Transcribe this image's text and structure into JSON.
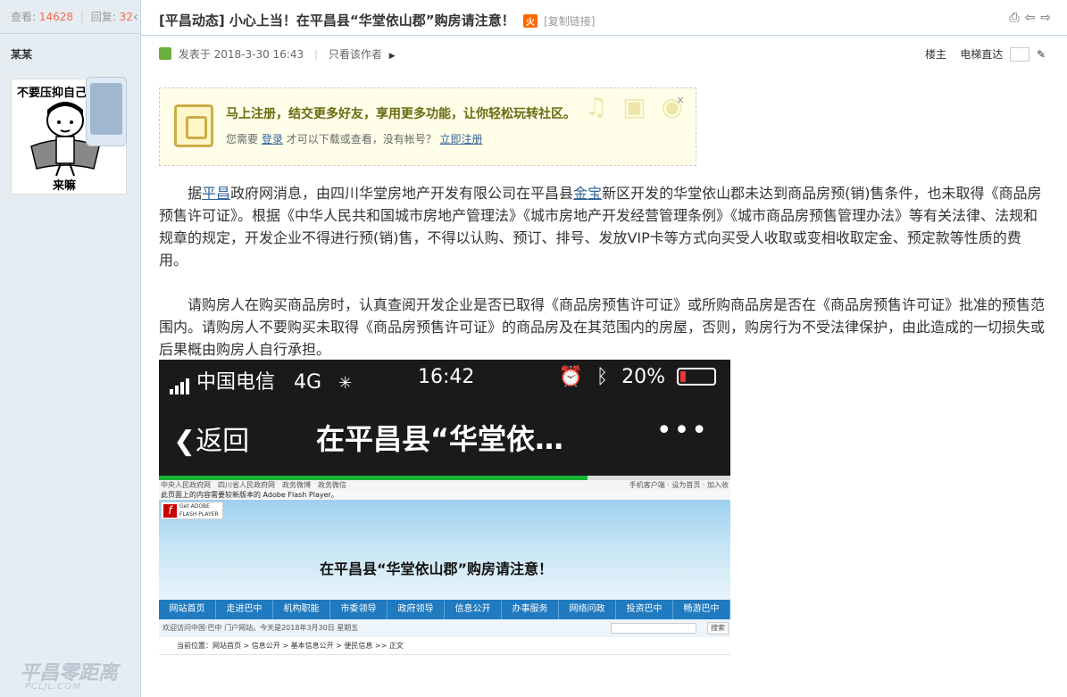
{
  "left": {
    "views_label": "查看:",
    "views": "14628",
    "sep": "|",
    "replies_label": "回复:",
    "replies": "32",
    "author": "某某",
    "avatar_caption_top": "不要压抑自己",
    "avatar_caption_bottom": "来嘛",
    "watermark": "平昌零距离",
    "watermark_sub": "PCLJL.COM"
  },
  "thread": {
    "title": "[平昌动态] 小心上当！在平昌县“华堂依山郡”购房请注意！",
    "hot_badge": "火",
    "copy_link": "[复制链接]",
    "posted_label": "发表于 2018-3-30 16:43",
    "only_author": "只看该作者",
    "floor": "楼主",
    "jump_label": "电梯直达"
  },
  "register_prompt": {
    "headline": "马上注册，结交更多好友，享用更多功能，让你轻松玩转社区。",
    "sub_prefix": "您需要",
    "login": "登录",
    "sub_mid": "才可以下载或查看，没有帐号？",
    "register": "立即注册"
  },
  "post": {
    "p1_start": "据",
    "p1_link1": "平昌",
    "p1_mid": "政府网消息，由四川华堂房地产开发有限公司在平昌县",
    "p1_link2": "金宝",
    "p1_rest": "新区开发的华堂依山郡未达到商品房预(销)售条件，也未取得《商品房预售许可证》。根据《中华人民共和国城市房地产管理法》《城市房地产开发经营管理条例》《城市商品房预售管理办法》等有关法律、法规和规章的规定，开发企业不得进行预(销)售，不得以认购、预订、排号、发放VIP卡等方式向买受人收取或变相收取定金、预定款等性质的费用。",
    "p2": "请购房人在购买商品房时，认真查阅开发企业是否已取得《商品房预售许可证》或所购商品房是否在《商品房预售许可证》批准的预售范围内。请购房人不要购买未取得《商品房预售许可证》的商品房及在其范围内的房屋，否则，购房行为不受法律保护，由此造成的一切损失或后果概由购房人自行承担。"
  },
  "screenshot": {
    "carrier": "中国电信",
    "network": "4G",
    "time": "16:42",
    "battery": "20%",
    "back": "返回",
    "page_title": "在平昌县“华堂依…",
    "more": "•••",
    "progress": 0.75,
    "gov_top_left": "中央人民政府网　四川省人民政府网　政务微博　政务微信",
    "gov_top_right": "手机客户端 · 设为首页 · 加入收",
    "flash_msg": "此页面上的内容需要较新版本的 Adobe Flash Player。",
    "flash_btn": "Get ADOBE FLASH PLAYER",
    "nav": [
      "网站首页",
      "走进巴中",
      "机构职能",
      "市委领导",
      "政府领导",
      "信息公开",
      "办事服务",
      "网络问政",
      "投资巴中",
      "畅游巴中"
    ],
    "welcome": "欢迎访问中国·巴中 门户网站。今天是2018年3月30日 星期五",
    "search_btn": "搜索",
    "crumbs": "当前位置：网站首页 > 信息公开 > 基本信息公开 > 便民信息 >> 正文",
    "article_title": "在平昌县“华堂依山郡”购房请注意！"
  }
}
